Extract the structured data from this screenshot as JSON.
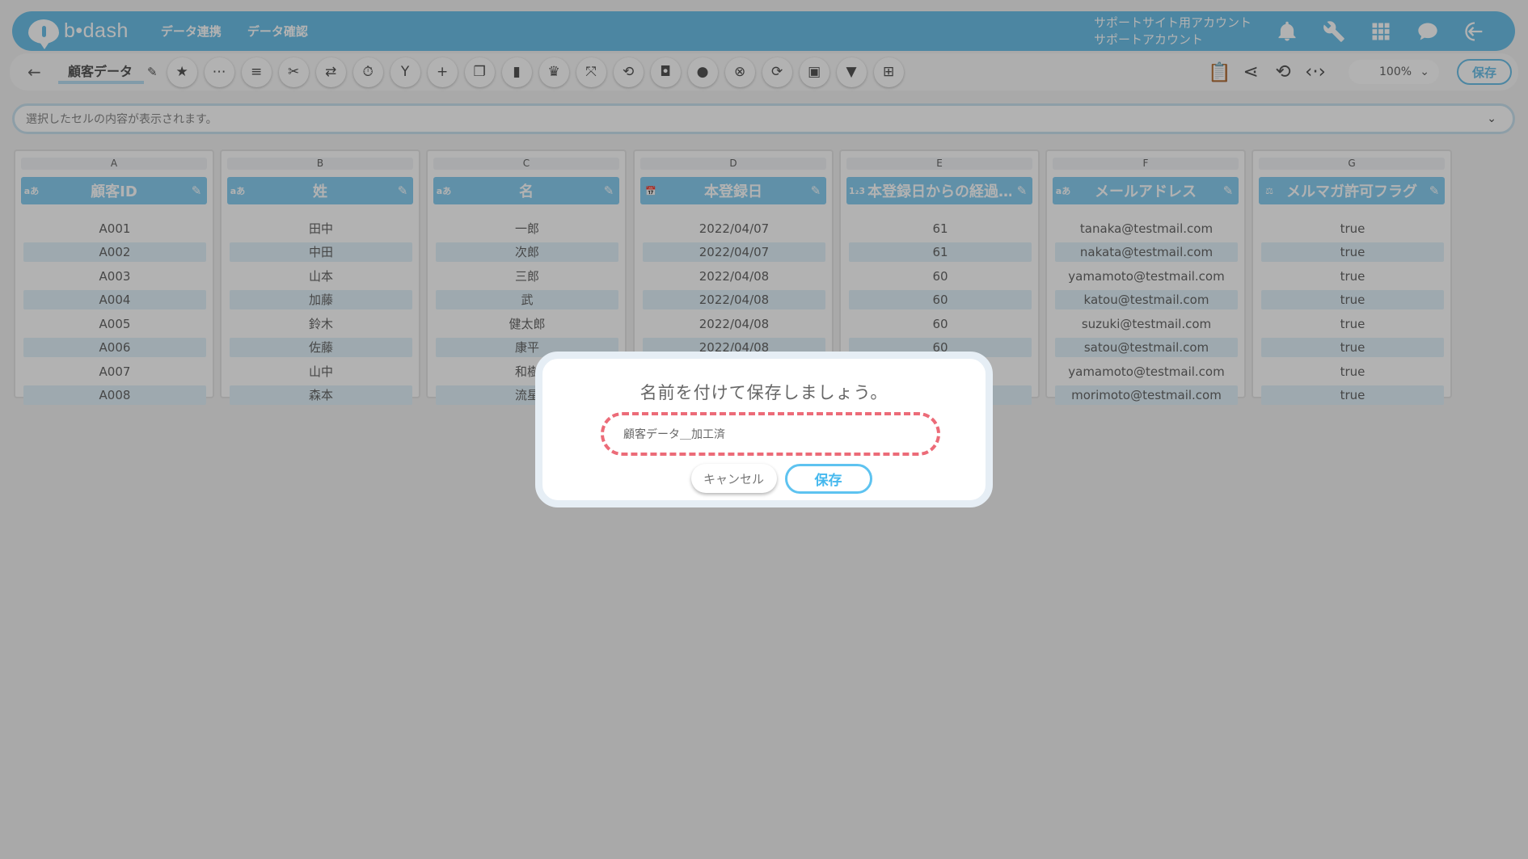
{
  "header": {
    "logo_text": "b•dash",
    "nav": [
      "データ連携",
      "データ確認"
    ],
    "account_line1": "サポートサイト用アカウント",
    "account_line2": "サポートアカウント"
  },
  "toolbar": {
    "filename": "顧客データ",
    "zoom": "100%",
    "save_label": "保存",
    "tool_icons": [
      "star-icon",
      "dots-icon",
      "list-icon",
      "tools-icon",
      "shuffle-icon",
      "timer-icon",
      "merge-icon",
      "plus-icon",
      "copy-icon",
      "trash-icon",
      "crown-icon",
      "expand-icon",
      "loop-icon",
      "lock-icon",
      "bag-icon",
      "cancel-circle-icon",
      "sync-icon",
      "box-icon",
      "filter-icon",
      "layers-icon"
    ]
  },
  "cellbar": {
    "placeholder": "選択したセルの内容が表示されます。"
  },
  "table": {
    "columns": [
      {
        "letter": "A",
        "type": "aあ",
        "title": "顧客ID",
        "cells": [
          "A001",
          "A002",
          "A003",
          "A004",
          "A005",
          "A006",
          "A007",
          "A008"
        ]
      },
      {
        "letter": "B",
        "type": "aあ",
        "title": "姓",
        "cells": [
          "田中",
          "中田",
          "山本",
          "加藤",
          "鈴木",
          "佐藤",
          "山中",
          "森本"
        ]
      },
      {
        "letter": "C",
        "type": "aあ",
        "title": "名",
        "cells": [
          "一郎",
          "次郎",
          "三郎",
          "武",
          "健太郎",
          "康平",
          "和樹",
          "流星"
        ]
      },
      {
        "letter": "D",
        "type": "📅",
        "title": "本登録日",
        "cells": [
          "2022/04/07",
          "2022/04/07",
          "2022/04/08",
          "2022/04/08",
          "2022/04/08",
          "2022/04/08",
          "",
          ""
        ]
      },
      {
        "letter": "E",
        "type": "1₂3",
        "title": "本登録日からの経過…",
        "cells": [
          "61",
          "61",
          "60",
          "60",
          "60",
          "60",
          "",
          ""
        ]
      },
      {
        "letter": "F",
        "type": "aあ",
        "title": "メールアドレス",
        "cells": [
          "tanaka@testmail.com",
          "nakata@testmail.com",
          "yamamoto@testmail.com",
          "katou@testmail.com",
          "suzuki@testmail.com",
          "satou@testmail.com",
          "yamamoto@testmail.com",
          "morimoto@testmail.com"
        ]
      },
      {
        "letter": "G",
        "type": "⚖",
        "title": "メルマガ許可フラグ",
        "cells": [
          "true",
          "true",
          "true",
          "true",
          "true",
          "true",
          "true",
          "true"
        ]
      }
    ]
  },
  "dialog": {
    "title": "名前を付けて保存しましょう。",
    "input_value": "顧客データ＿加工済",
    "cancel_label": "キャンセル",
    "save_label": "保存"
  }
}
